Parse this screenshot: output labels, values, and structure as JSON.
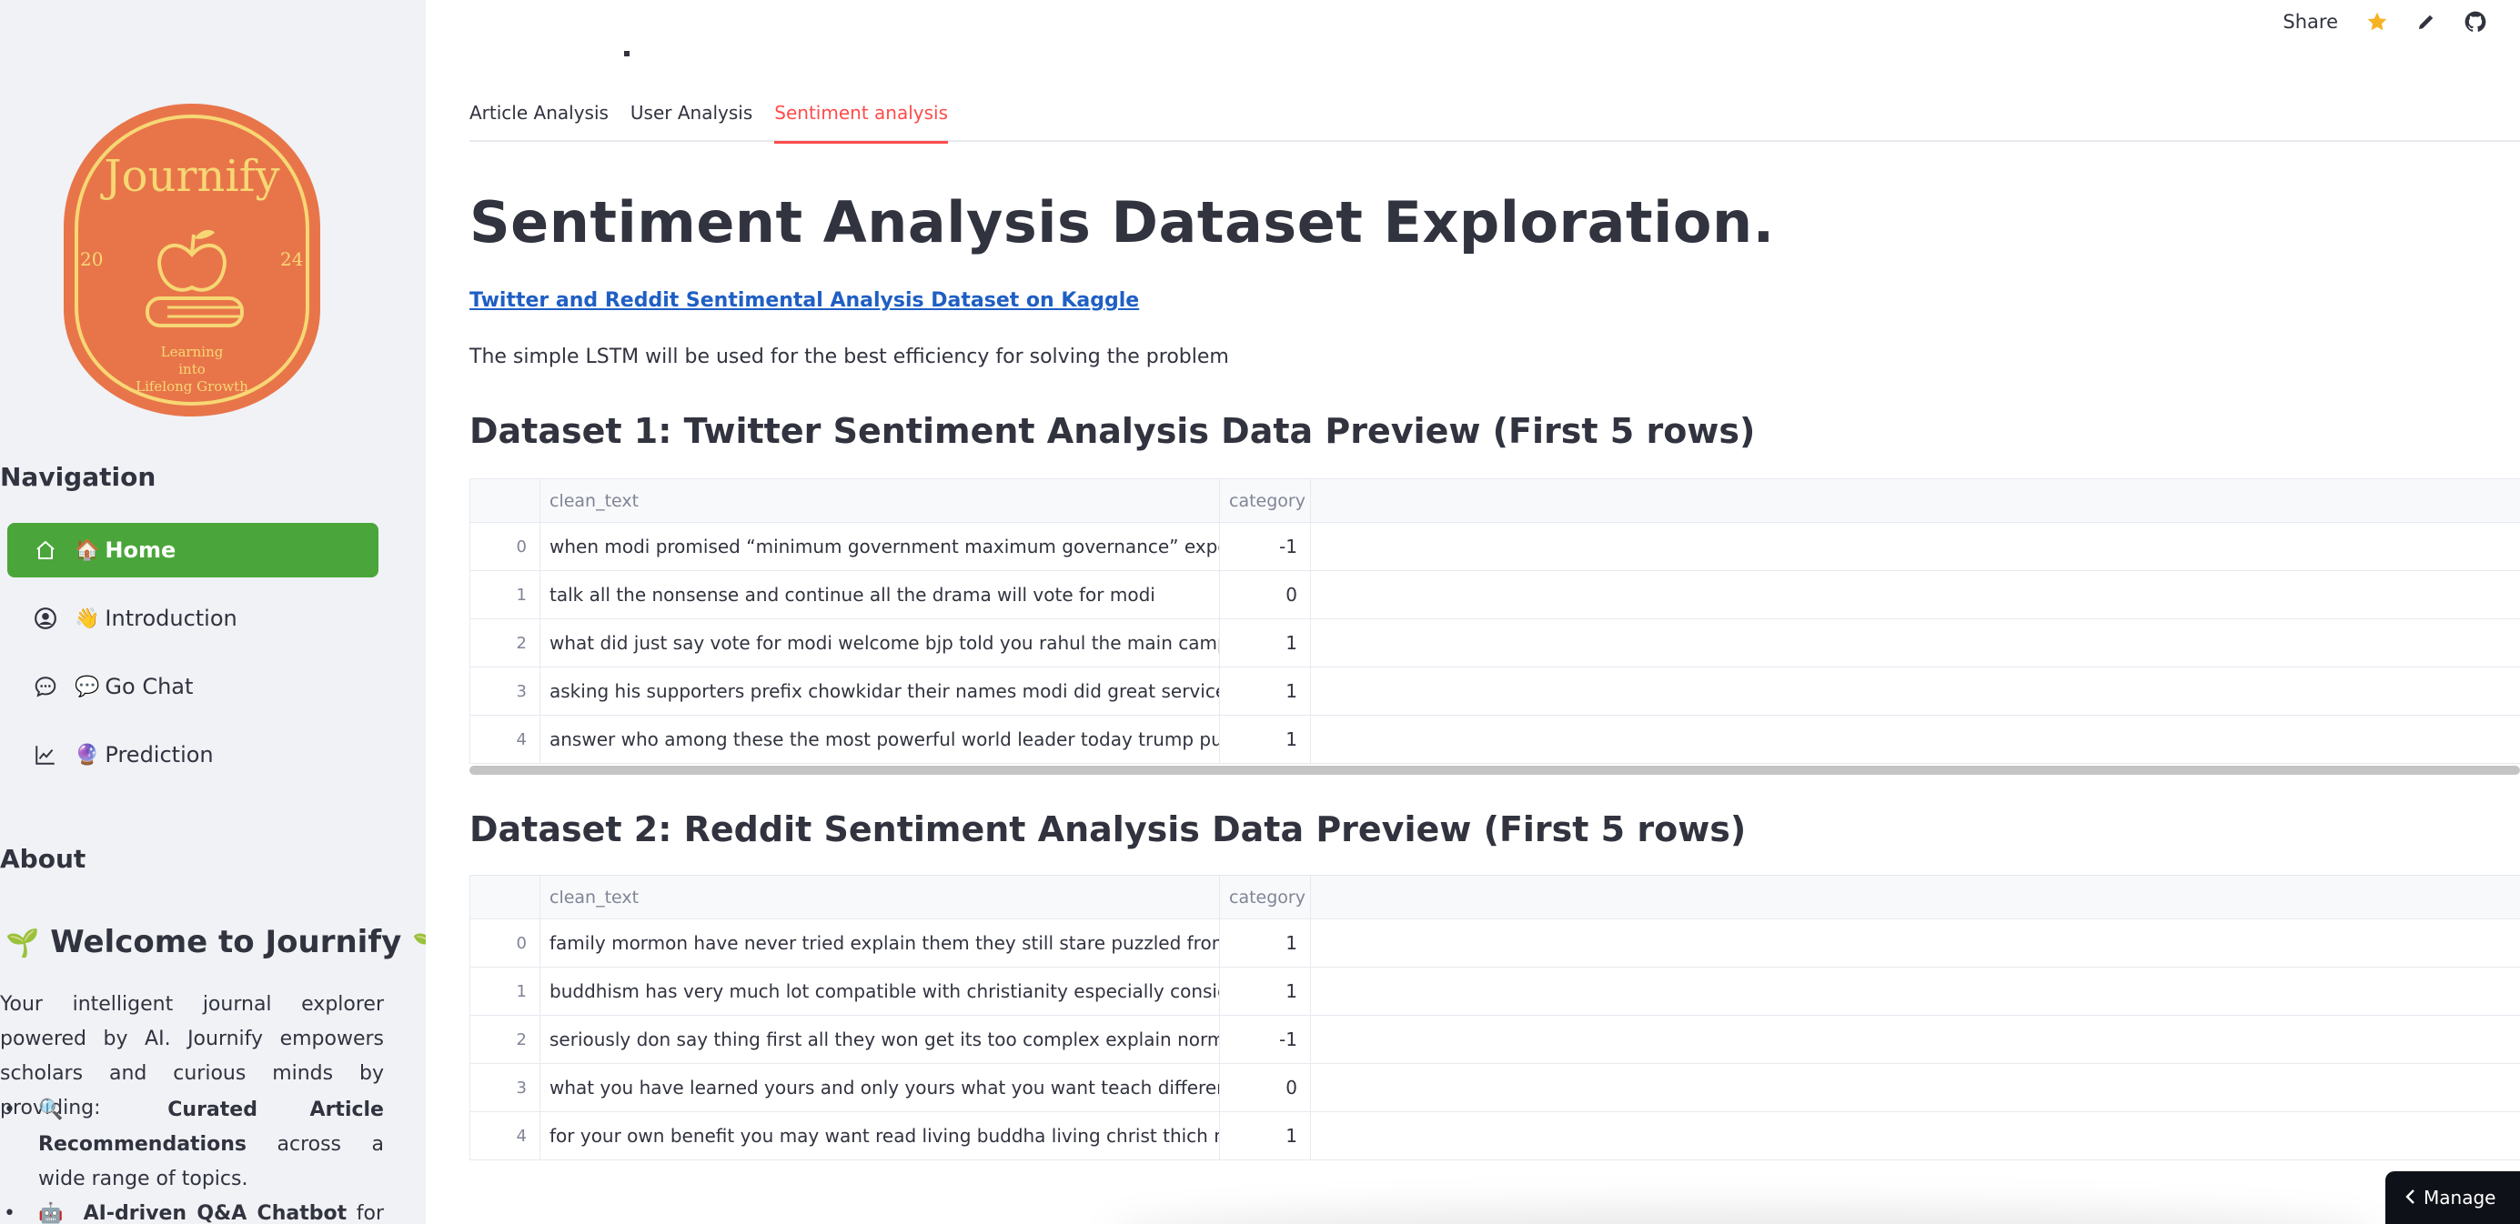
{
  "sidebar": {
    "logo": {
      "brand": "Journify",
      "year_left": "20",
      "year_right": "24",
      "tagline": [
        "Learning",
        "into",
        "Lifelong Growth"
      ],
      "colors": {
        "bg": "#e8754a",
        "ring": "#f7d774"
      }
    },
    "nav_heading": "Navigation",
    "nav_items": [
      {
        "icon": "home-icon",
        "emoji": "🏠",
        "label": "Home",
        "active": true
      },
      {
        "icon": "user-circle-icon",
        "emoji": "👋",
        "label": "Introduction",
        "active": false
      },
      {
        "icon": "chat-bubble-icon",
        "emoji": "💬",
        "label": "Go Chat",
        "active": false
      },
      {
        "icon": "line-chart-icon",
        "emoji": "🔮",
        "label": "Prediction",
        "active": false
      }
    ],
    "about_heading": "About",
    "welcome": "Welcome to Journify",
    "welcome_emoji": "🌱",
    "about_text": "Your intelligent journal explorer powered by AI. Journify empowers scholars and curious minds by providing:",
    "about_list": [
      {
        "icon": "🔍",
        "bold": "Curated Article Recommendations",
        "rest": " across a wide range of topics."
      },
      {
        "icon": "🤖",
        "bold": "AI-driven Q&A Chatbot",
        "rest": " for quick"
      }
    ]
  },
  "topbar": {
    "share": "Share"
  },
  "tabs": [
    {
      "label": "Article Analysis",
      "active": false
    },
    {
      "label": "User Analysis",
      "active": false
    },
    {
      "label": "Sentiment analysis",
      "active": true
    }
  ],
  "main": {
    "title": "Sentiment Analysis Dataset Exploration.",
    "link": "Twitter and Reddit Sentimental Analysis Dataset on Kaggle",
    "description": "The simple LSTM will be used for the best efficiency for solving the problem",
    "dataset1": {
      "heading": "Dataset 1: Twitter Sentiment Analysis Data Preview (First 5 rows)",
      "columns": [
        "clean_text",
        "category"
      ],
      "rows": [
        {
          "idx": "0",
          "clean_text": "when modi promised “minimum government maximum governance” expected him b",
          "category": "-1"
        },
        {
          "idx": "1",
          "clean_text": "talk all the nonsense and continue all the drama will vote for modi",
          "category": "0"
        },
        {
          "idx": "2",
          "clean_text": "what did just say vote for modi  welcome bjp told you rahul the main campaigner for",
          "category": "1"
        },
        {
          "idx": "3",
          "clean_text": "asking his supporters prefix chowkidar their names modi did great service now there",
          "category": "1"
        },
        {
          "idx": "4",
          "clean_text": "answer who among these the most powerful world leader today trump putin modi m",
          "category": "1"
        }
      ]
    },
    "dataset2": {
      "heading": "Dataset 2: Reddit Sentiment Analysis Data Preview (First 5 rows)",
      "columns": [
        "clean_text",
        "category"
      ],
      "rows": [
        {
          "idx": "0",
          "clean_text": " family mormon have never tried explain them they still stare puzzled from time time",
          "category": "1"
        },
        {
          "idx": "1",
          "clean_text": "buddhism has very much lot compatible with christianity especially considering that",
          "category": "1"
        },
        {
          "idx": "2",
          "clean_text": "seriously don say thing first all they won get its too complex explain normal people ar",
          "category": "-1"
        },
        {
          "idx": "3",
          "clean_text": "what you have learned yours and only yours what you want teach different focus the",
          "category": "0"
        },
        {
          "idx": "4",
          "clean_text": "for your own benefit you may want read living buddha living christ thich nhat hanh yo",
          "category": "1"
        }
      ]
    }
  },
  "manage_button": "Manage"
}
